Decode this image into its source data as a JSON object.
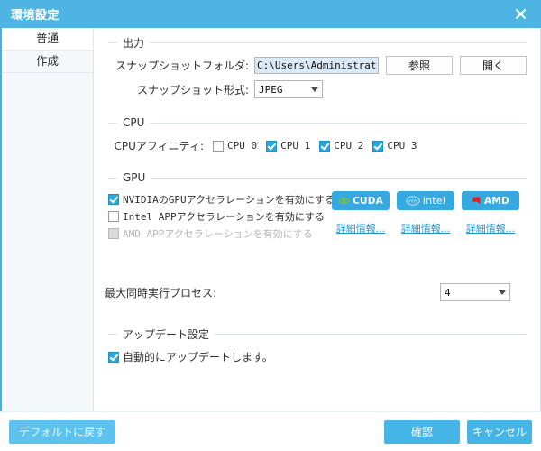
{
  "window": {
    "title": "環境設定",
    "close_icon": "close-icon",
    "accent_color": "#4db4e4"
  },
  "sidebar": {
    "items": [
      {
        "label": "普通",
        "selected": true
      },
      {
        "label": "作成",
        "selected": false
      }
    ]
  },
  "output": {
    "legend": "出力",
    "folder_label": "スナップショットフォルダ:",
    "folder_value": "C:\\Users\\Administrator",
    "browse_label": "参照",
    "open_label": "開く",
    "format_label": "スナップショット形式:",
    "format_value": "JPEG"
  },
  "cpu": {
    "legend": "CPU",
    "affinity_label": "CPUアフィニティ:",
    "items": [
      {
        "label": "CPU 0",
        "checked": false
      },
      {
        "label": "CPU 1",
        "checked": true
      },
      {
        "label": "CPU 2",
        "checked": true
      },
      {
        "label": "CPU 3",
        "checked": true
      }
    ]
  },
  "gpu": {
    "legend": "GPU",
    "options": [
      {
        "label": "NVIDIAのGPUアクセラレーションを有効にする",
        "checked": true,
        "disabled": false
      },
      {
        "label": "Intel APPアクセラレーションを有効にする",
        "checked": false,
        "disabled": false
      },
      {
        "label": "AMD APPアクセラレーションを有効にする",
        "checked": false,
        "disabled": true
      }
    ],
    "badges": [
      {
        "label": "CUDA",
        "icon": "nvidia-cuda-icon",
        "color": "#36a9e1"
      },
      {
        "label": "intel",
        "icon": "intel-icon",
        "color": "#36a9e1"
      },
      {
        "label": "AMD",
        "icon": "amd-icon",
        "color": "#36a9e1"
      }
    ],
    "links": [
      {
        "label": "詳細情報..."
      },
      {
        "label": "詳細情報..."
      },
      {
        "label": "詳細情報..."
      }
    ]
  },
  "processes": {
    "label": "最大同時実行プロセス:",
    "value": "4"
  },
  "update": {
    "legend": "アップデート設定",
    "auto_label": "自動的にアップデートします。",
    "auto_checked": true
  },
  "footer": {
    "reset_label": "デフォルトに戻す",
    "confirm_label": "確認",
    "cancel_label": "キャンセル"
  }
}
